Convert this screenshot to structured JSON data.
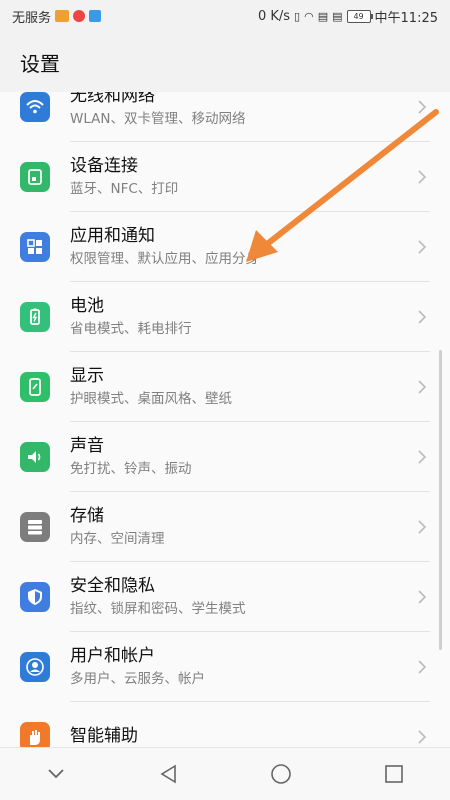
{
  "status_bar": {
    "carrier": "无服务",
    "speed": "0 K/s",
    "battery": "49",
    "time": "中午11:25"
  },
  "header": {
    "title": "设置"
  },
  "settings": [
    {
      "title": "无线和网络",
      "subtitle": "WLAN、双卡管理、移动网络",
      "icon": "wifi-icon",
      "color": "#2f7bd8"
    },
    {
      "title": "设备连接",
      "subtitle": "蓝牙、NFC、打印",
      "icon": "device-connect-icon",
      "color": "#33b86a"
    },
    {
      "title": "应用和通知",
      "subtitle": "权限管理、默认应用、应用分身",
      "icon": "apps-icon",
      "color": "#3f7ee0"
    },
    {
      "title": "电池",
      "subtitle": "省电模式、耗电排行",
      "icon": "battery-icon",
      "color": "#33c07a"
    },
    {
      "title": "显示",
      "subtitle": "护眼模式、桌面风格、壁纸",
      "icon": "display-icon",
      "color": "#2fbf6a"
    },
    {
      "title": "声音",
      "subtitle": "免打扰、铃声、振动",
      "icon": "sound-icon",
      "color": "#33b86a"
    },
    {
      "title": "存储",
      "subtitle": "内存、空间清理",
      "icon": "storage-icon",
      "color": "#7d7d7d"
    },
    {
      "title": "安全和隐私",
      "subtitle": "指纹、锁屏和密码、学生模式",
      "icon": "shield-icon",
      "color": "#3f7ee0"
    },
    {
      "title": "用户和帐户",
      "subtitle": "多用户、云服务、帐户",
      "icon": "user-icon",
      "color": "#2f7bd8"
    },
    {
      "title": "智能辅助",
      "subtitle": "",
      "icon": "hand-icon",
      "color": "#f07a2a"
    }
  ],
  "annotation": {
    "arrow_color": "#f0883a"
  }
}
